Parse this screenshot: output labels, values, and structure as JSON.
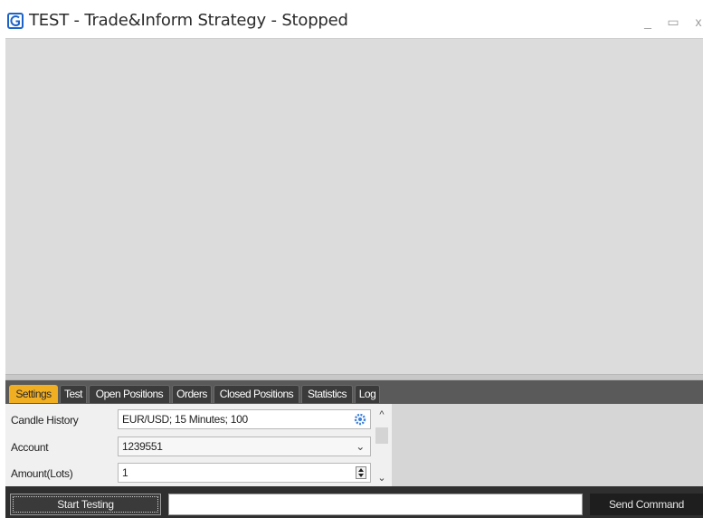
{
  "window": {
    "title": "TEST - Trade&Inform Strategy - Stopped",
    "minimize_glyph": "_",
    "maximize_glyph": "▭",
    "close_glyph": "x"
  },
  "tabs": [
    {
      "label": "Settings",
      "active": true
    },
    {
      "label": "Test",
      "active": false
    },
    {
      "label": "Open Positions",
      "active": false
    },
    {
      "label": "Orders",
      "active": false
    },
    {
      "label": "Closed Positions",
      "active": false
    },
    {
      "label": "Statistics",
      "active": false
    },
    {
      "label": "Log",
      "active": false
    }
  ],
  "settings": {
    "candle_history": {
      "label": "Candle History",
      "value": "EUR/USD; 15 Minutes; 100"
    },
    "account": {
      "label": "Account",
      "value": "1239551"
    },
    "amount": {
      "label": "Amount(Lots)",
      "value": "1"
    }
  },
  "bottom": {
    "start_label": "Start Testing",
    "command_value": "",
    "send_label": "Send Command"
  },
  "icons": {
    "app": "app-logo-icon",
    "gear": "gear-icon",
    "dropdown": "chevron-down-icon",
    "spinner": "spinner-icon"
  },
  "colors": {
    "active_tab": "#f0ae22",
    "tab_bg": "#3b3b3b",
    "bottom_bar": "#2f2f2f",
    "chart_bg": "#dcdcdc"
  }
}
